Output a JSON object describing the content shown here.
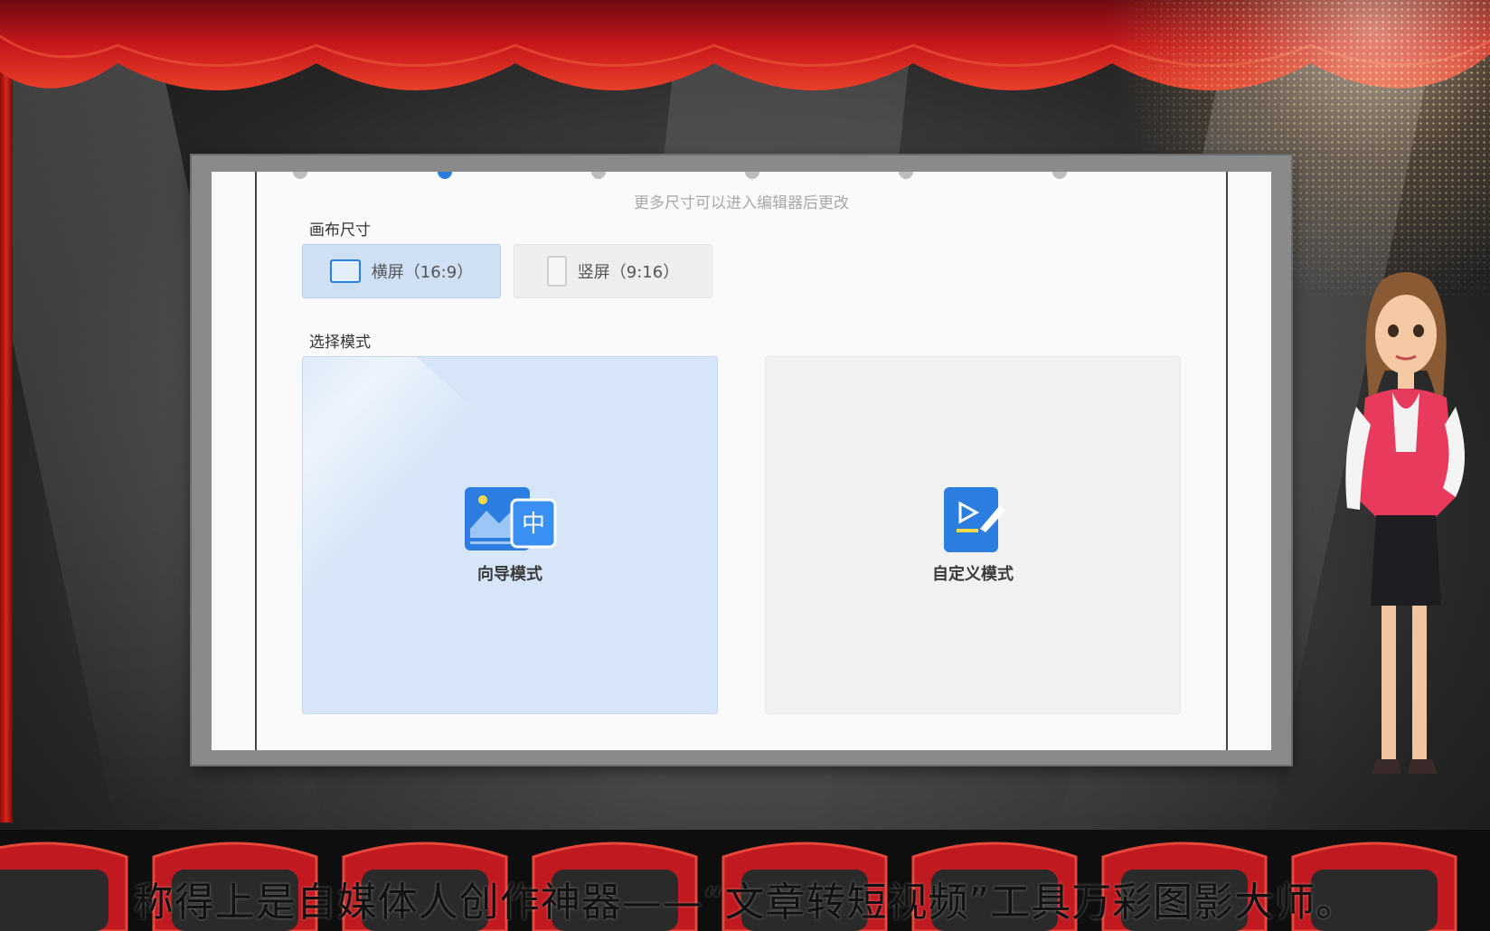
{
  "app": {
    "hint_text": "更多尺寸可以进入编辑器后更改",
    "canvas_size": {
      "label": "画布尺寸",
      "options": [
        {
          "label": "横屏（16:9）",
          "selected": true,
          "icon": "landscape-icon"
        },
        {
          "label": "竖屏（9:16）",
          "selected": false,
          "icon": "portrait-icon"
        }
      ]
    },
    "mode_select": {
      "label": "选择模式",
      "modes": [
        {
          "label": "向导模式",
          "selected": true,
          "icon": "wizard-mode-icon"
        },
        {
          "label": "自定义模式",
          "selected": false,
          "icon": "custom-mode-icon"
        }
      ]
    }
  },
  "video": {
    "subtitle": "称得上是自媒体人创作神器——“文章转短视频”工具万彩图影大师。"
  },
  "colors": {
    "accent": "#2b7de0",
    "selected_bg": "#d6e6f8",
    "curtain_red": "#c8171b"
  }
}
